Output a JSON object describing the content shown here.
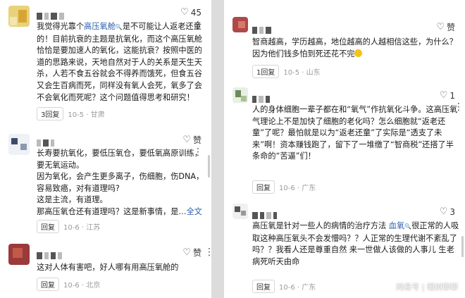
{
  "left": {
    "c1": {
      "likes": "45",
      "body_pre": "我觉得光靠个",
      "body_link": "高压氧舱",
      "body_post": "是不可能让人返老还童的！目前抗衰的主题是抗氧化，而这个高压氧舱恰恰是要加速人的氧化，这能抗衰？按照中医的道的思路来说，天地自然对于人的关系是天生天杀，人若不食五谷就会不得养而饿死，但食五谷又会生百病而死，同样没有氧人会死，氧多了会不会氧化而死呢？这个问题值得思考和研究！",
      "reply": "3回复",
      "meta": "10-5 · 甘肃"
    },
    "c2": {
      "likes": "赞",
      "body": "长寿要抗氧化，要低压氧仓，要低氧高原训练，要无氧运动。\n因为氧化，会产生更多离子，伤细胞，伤DNA，容易致癌，对有道理吗?\n这是主流，有道理。\n那高压氧仓还有道理吗？这是新事情，是…",
      "more_link": "全文",
      "reply": "回复",
      "meta": "10-6 · 江苏"
    },
    "c3": {
      "likes": "赞",
      "body": "这对人体有害吧，好人哪有用高压氧舱的",
      "reply": "回复",
      "meta": "10-6 · 北京"
    }
  },
  "right": {
    "c1": {
      "likes": "赞",
      "body": "智商越高，学历越高，地位越高的人越相信这些，为什么？因为他们钱多怕到死还花不完",
      "reply": "1回复",
      "meta": "10-5 · 山东"
    },
    "c2": {
      "likes": "1",
      "body": "人的身体细胞一辈子都在和“氧气”作抗氧化斗争。这高压氧气理论上不是加快了细胞的老化吗？怎么细胞就“返老还童”了呢？最怕就是以为“返老还童”了实际是“透支了未来”啊！资本赚钱跑了，留下了一堆缴了“智商税”还搭了半条命的“苦逼”们！",
      "reply": "回复",
      "meta": "10-6 · 广东"
    },
    "c3": {
      "likes": "3",
      "body_pre": "高压氧是针对一些人的病情的治疗方法 ",
      "body_link": "血氧",
      "body_post": "很正常的人吸取这种高压氧头不会发懵吗？？人正常的生理代谢不紊乱了吗？？我看人还是尊重自然 来一世做人该做的人事儿 生老病死听天由命",
      "reply": "回复",
      "meta": "10-6 · 广东"
    },
    "watermark": "网易号 | 暖树聊聊"
  },
  "icons": {
    "like": "heart-icon",
    "more": "more-dots-icon",
    "search_chip": "search-icon"
  },
  "colors": {
    "link": "#2a5caa",
    "meta": "#9a9a9a"
  }
}
